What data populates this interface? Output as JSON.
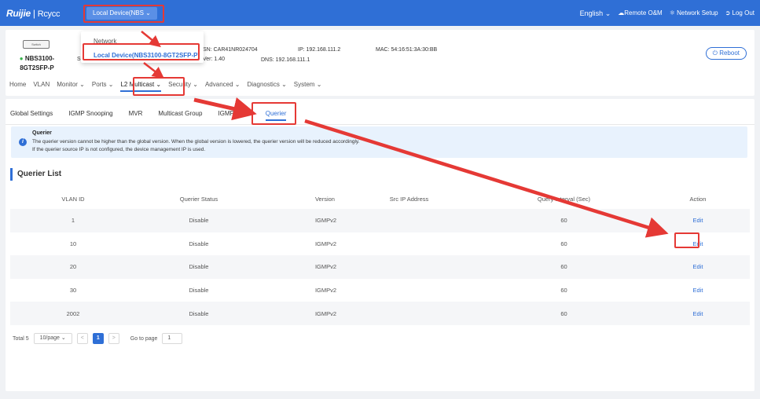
{
  "header": {
    "logo": "Ruijie",
    "logo_sep": "|",
    "logo_sub": "Rcycc",
    "device_select": "Local Device(NBS",
    "device_select_icon": "chevron-down-icon",
    "language": "English",
    "language_icon": "chevron-down-icon",
    "remote_om": "Remote O&M",
    "remote_om_icon": "cloud-icon",
    "network_setup": "Network Setup",
    "network_setup_icon": "network-icon",
    "logout": "Log Out",
    "logout_icon": "logout-icon"
  },
  "device_dropdown": {
    "options": [
      "Network",
      "Local Device(NBS3100-8GT2SFP-P)"
    ],
    "selected": "Local Device(NBS3100-8GT2SFP-P)"
  },
  "device": {
    "icon_label": "Switch",
    "status_dot": "●",
    "name": "NBS3100-8GT2SFP-P",
    "sn": "SN: CAR41NR024704",
    "ip": "IP: 192.168.111.2",
    "mac": "MAC: 54:16:51:3A:30:BB",
    "ver": "Ver: 1.40",
    "dns": "DNS: 192.168.111.1",
    "partial_s": "S",
    "partial_r": "r",
    "reboot": "Reboot"
  },
  "nav": {
    "items": [
      "Home",
      "VLAN",
      "Monitor",
      "Ports",
      "L2 Multicast",
      "Security",
      "Advanced",
      "Diagnostics",
      "System"
    ],
    "active": "L2 Multicast"
  },
  "subtabs": {
    "items": [
      "Global Settings",
      "IGMP Snooping",
      "MVR",
      "Multicast Group",
      "IGMP Filter",
      "Querier"
    ],
    "active": "Querier"
  },
  "notice": {
    "title": "Querier",
    "line1": "The querier version cannot be higher than the global version. When the global version is lowered, the querier version will be reduced accordingly.",
    "line2": "If the querier source IP is not configured, the device management IP is used.",
    "icon": "info-icon"
  },
  "list": {
    "title": "Querier List",
    "columns": [
      "VLAN ID",
      "Querier Status",
      "Version",
      "Src IP Address",
      "Query Interval (Sec)",
      "Action"
    ],
    "rows": [
      {
        "vlan": "1",
        "status": "Disable",
        "version": "IGMPv2",
        "src": "",
        "interval": "60",
        "action": "Edit"
      },
      {
        "vlan": "10",
        "status": "Disable",
        "version": "IGMPv2",
        "src": "",
        "interval": "60",
        "action": "Edit"
      },
      {
        "vlan": "20",
        "status": "Disable",
        "version": "IGMPv2",
        "src": "",
        "interval": "60",
        "action": "Edit"
      },
      {
        "vlan": "30",
        "status": "Disable",
        "version": "IGMPv2",
        "src": "",
        "interval": "60",
        "action": "Edit"
      },
      {
        "vlan": "2002",
        "status": "Disable",
        "version": "IGMPv2",
        "src": "",
        "interval": "60",
        "action": "Edit"
      }
    ]
  },
  "pagination": {
    "total": "Total 5",
    "page_size": "10/page",
    "prev": "<",
    "current": "1",
    "next": ">",
    "goto_label": "Go to page",
    "goto_value": "1"
  },
  "colors": {
    "brand_blue": "#2f6fd6",
    "annotation_red": "#e53935",
    "status_green": "#35b24a"
  }
}
